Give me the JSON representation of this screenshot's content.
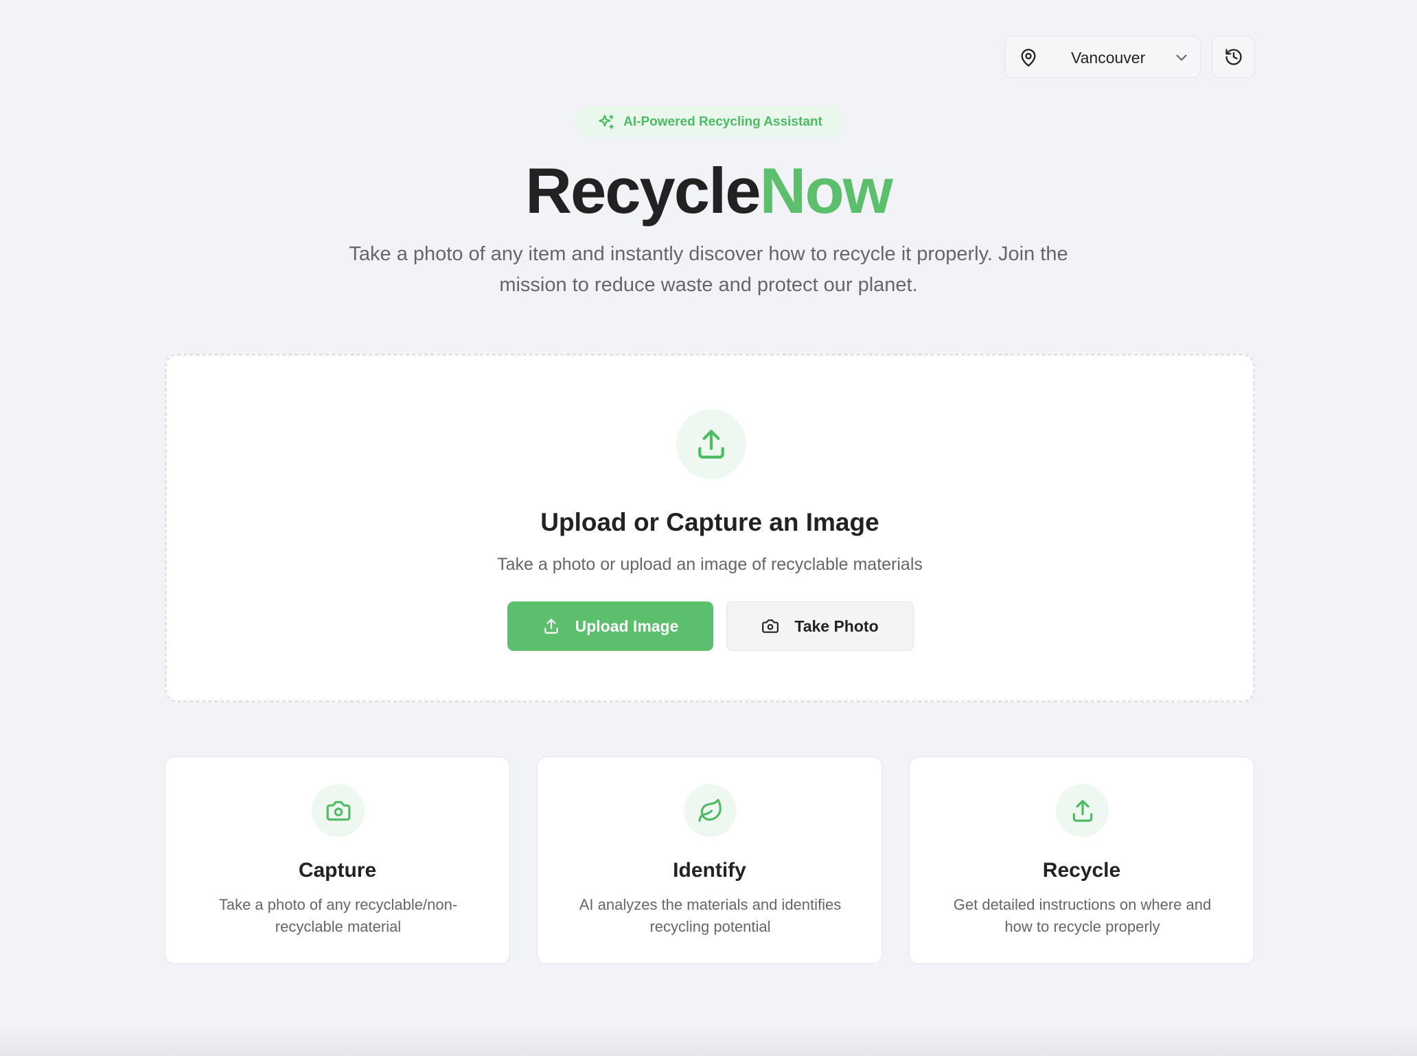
{
  "header": {
    "location": {
      "value": "Vancouver",
      "icon": "map-pin-icon"
    },
    "history_icon": "history-icon"
  },
  "hero": {
    "badge": {
      "icon": "sparkles-icon",
      "text": "AI-Powered Recycling Assistant"
    },
    "title_part1": "Recycle",
    "title_part2": "Now",
    "subtitle": "Take a photo of any item and instantly discover how to recycle it properly. Join the mission to reduce waste and protect our planet."
  },
  "upload": {
    "icon": "upload-icon",
    "heading": "Upload or Capture an Image",
    "subheading": "Take a photo or upload an image of recyclable materials",
    "upload_button": "Upload Image",
    "photo_button": "Take Photo"
  },
  "features": [
    {
      "icon": "camera-icon",
      "title": "Capture",
      "description": "Take a photo of any recyclable/non-recyclable material"
    },
    {
      "icon": "leaf-icon",
      "title": "Identify",
      "description": "AI analyzes the materials and identifies recycling potential"
    },
    {
      "icon": "upload-icon",
      "title": "Recycle",
      "description": "Get detailed instructions on where and how to recycle properly"
    }
  ],
  "colors": {
    "accent": "#5cbf6d",
    "accent_light": "#eef8f0",
    "background": "#f2f3f6",
    "text_primary": "#222222",
    "text_secondary": "#666666"
  }
}
